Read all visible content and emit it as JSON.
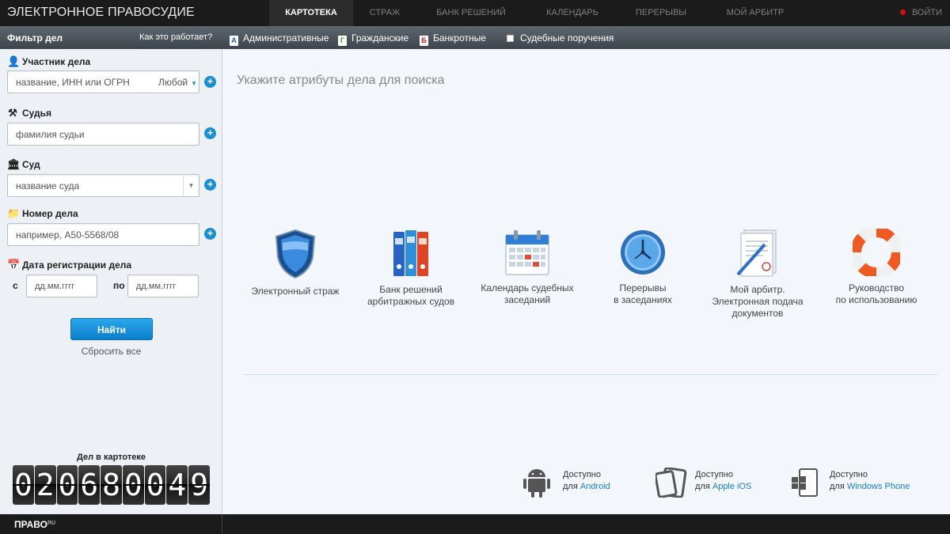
{
  "header": {
    "brand": "ЭЛЕКТРОННОЕ ПРАВОСУДИЕ",
    "nav": [
      "КАРТОТЕКА",
      "СТРАЖ",
      "БАНК РЕШЕНИЙ",
      "КАЛЕНДАРЬ",
      "ПЕРЕРЫВЫ",
      "МОЙ АРБИТР"
    ],
    "active_nav": "КАРТОТЕКА",
    "logout": "ВОЙТИ"
  },
  "filterbar": {
    "title": "Фильтр дел",
    "how": "Как это работает?",
    "categories": [
      {
        "icon_letter": "А",
        "label": "Административные",
        "color": "#1a5fb4"
      },
      {
        "icon_letter": "Г",
        "label": "Гражданские",
        "color": "#2e9a2e"
      },
      {
        "icon_letter": "Б",
        "label": "Банкротные",
        "color": "#c01818"
      }
    ],
    "assignments": "Судебные поручения"
  },
  "sidebar": {
    "participant": {
      "label": "Участник дела",
      "placeholder": "название, ИНН или ОГРН",
      "type": "Любой"
    },
    "judge": {
      "label": "Судья",
      "placeholder": "фамилия судьи"
    },
    "court": {
      "label": "Суд",
      "placeholder": "название суда"
    },
    "case_number": {
      "label": "Номер дела",
      "placeholder": "например, А50-5568/08"
    },
    "reg_date": {
      "label": "Дата регистрации дела",
      "from_label": "с",
      "to_label": "по",
      "from_placeholder": "дд.мм.гггг",
      "to_placeholder": "дд.мм.гггг"
    },
    "find_button": "Найти",
    "reset": "Сбросить все",
    "count_label": "Дел в картотеке",
    "count_digits": [
      "0",
      "2",
      "0",
      "6",
      "8",
      "0",
      "0",
      "4",
      "9"
    ]
  },
  "main": {
    "title": "Укажите атрибуты дела для поиска",
    "tiles": [
      {
        "line1": "Электронный страж",
        "line2": "",
        "line3": ""
      },
      {
        "line1": "Банк решений",
        "line2": "арбитражных судов",
        "line3": ""
      },
      {
        "line1": "Календарь судебных",
        "line2": "заседаний",
        "line3": ""
      },
      {
        "line1": "Перерывы",
        "line2": "в заседаниях",
        "line3": ""
      },
      {
        "line1": "Мой арбитр.",
        "line2": "Электронная подача",
        "line3": "документов"
      },
      {
        "line1": "Руководство",
        "line2": "по использованию",
        "line3": ""
      }
    ],
    "apps": [
      {
        "available": "Доступно",
        "for": "для",
        "platform": "Android"
      },
      {
        "available": "Доступно",
        "for": "для",
        "platform": "Apple iOS"
      },
      {
        "available": "Доступно",
        "for": "для",
        "platform": "Windows Phone"
      }
    ]
  },
  "footer": {
    "logo": "ПРАВО",
    "logo_suffix": "RU"
  }
}
